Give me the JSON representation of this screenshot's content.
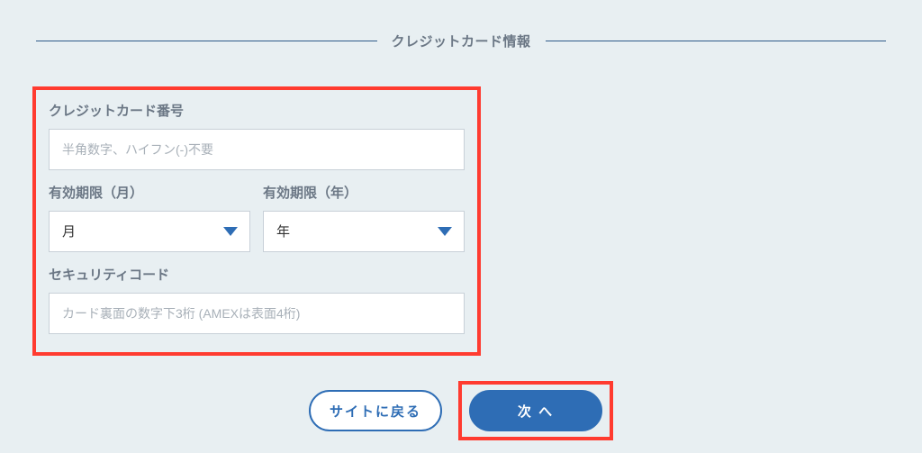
{
  "section": {
    "title": "クレジットカード情報"
  },
  "form": {
    "card_number": {
      "label": "クレジットカード番号",
      "placeholder": "半角数字、ハイフン(-)不要",
      "value": ""
    },
    "exp_month": {
      "label": "有効期限（月）",
      "selected": "月"
    },
    "exp_year": {
      "label": "有効期限（年）",
      "selected": "年"
    },
    "security_code": {
      "label": "セキュリティコード",
      "placeholder": "カード裏面の数字下3桁 (AMEXは表面4桁)",
      "value": ""
    }
  },
  "buttons": {
    "back": "サイトに戻る",
    "next": "次 へ"
  },
  "colors": {
    "highlight": "#ff3b30",
    "primary": "#2e6db5",
    "bg": "#e8eff2"
  }
}
